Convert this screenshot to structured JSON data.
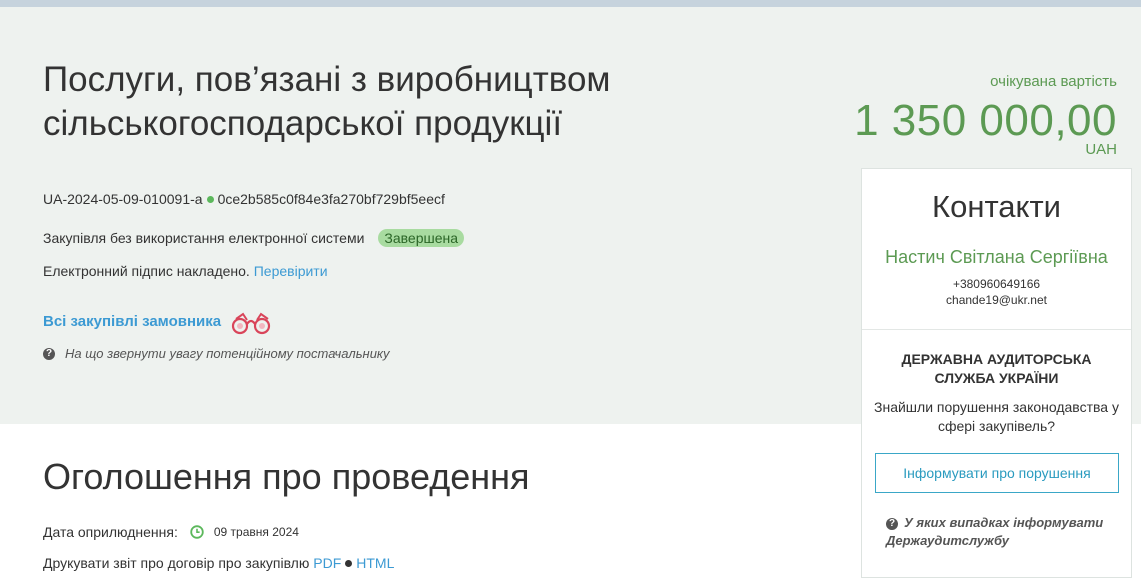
{
  "tender": {
    "title": "Послуги, пов’язані з виробництвом сільськогосподарської продукції",
    "id": "UA-2024-05-09-010091-a",
    "hash": "0ce2b585c0f84e3fa270bf729bf5eecf",
    "procedure": "Закупівля без використання електронної системи",
    "status": "Завершена",
    "signature_text": "Електронний підпис накладено.",
    "verify_link": "Перевірити",
    "all_purchases_link": "Всі закупівлі замовника",
    "supplier_hint": "На що звернути увагу потенційному постачальнику"
  },
  "cost": {
    "label": "очікувана вартість",
    "value": "1 350 000,00",
    "currency": "UAH"
  },
  "announcement": {
    "title": "Оголошення про проведення",
    "date_label": "Дата оприлюднення:",
    "date_value": "09 травня 2024",
    "print_text": "Друкувати звіт про договір про закупівлю",
    "pdf_link": "PDF",
    "html_link": "HTML"
  },
  "contacts": {
    "title": "Контакти",
    "name": "Настич Світлана Сергіївна",
    "phone": "+380960649166",
    "email": "chande19@ukr.net"
  },
  "audit": {
    "title": "ДЕРЖАВНА АУДИТОРСЬКА СЛУЖБА УКРАЇНИ",
    "text": "Знайшли порушення законодавства у сфері закупівель?",
    "button": "Інформувати про порушення",
    "hint": "У яких випадках інформувати Держаудитслужбу"
  },
  "colors": {
    "accent_green": "#5c9a53",
    "link_blue": "#3c9ad3",
    "badge_bg": "#a8dba0",
    "hero_bg": "#eef2ef"
  }
}
